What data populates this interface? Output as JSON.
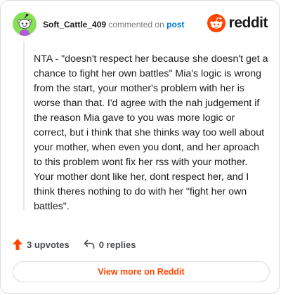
{
  "header": {
    "username": "Soft_Cattle_409",
    "commented_text": "commented on",
    "post_link": "post",
    "brand": "reddit",
    "brand_color": "#ff4500"
  },
  "avatar": {
    "icon": "snoo-avatar-icon",
    "background": "#86e057",
    "accent": "#b25bd8"
  },
  "comment": {
    "body": "NTA - \"doesn't respect her because she doesn't get a chance to fight her own battles\" Mia's logic is wrong from the start, your mother's problem with her is worse than that. I'd agree with the nah judgement if the reason Mia gave to you was more logic or correct, but i think that she thinks way too well about your mother, when even you dont, and her aproach to this problem wont fix her rss with your mother. Your mother dont like her, dont respect her, and I think theres nothing to do with her \"fight her own battles\"."
  },
  "actions": {
    "upvotes_label": "3 upvotes",
    "upvote_icon": "upvote-arrow-icon",
    "upvote_color": "#ff4500",
    "replies_label": "0 replies",
    "reply_icon": "reply-arrow-icon"
  },
  "footer": {
    "view_more_label": "View more on Reddit"
  }
}
